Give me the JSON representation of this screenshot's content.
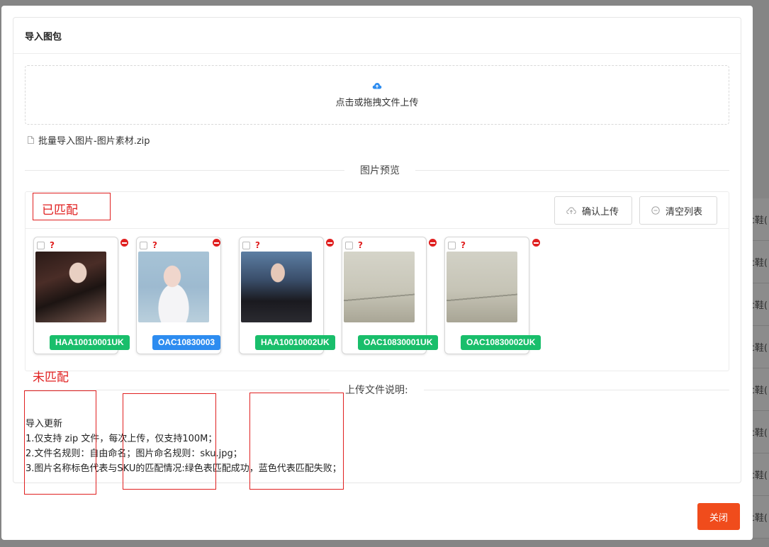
{
  "background": {
    "row_text": "c鞋("
  },
  "modal": {
    "title": "导入图包",
    "dropzone_text": "点击或拖拽文件上传",
    "file_name": "批量导入图片-图片素材.zip",
    "preview_divider": "图片预览",
    "confirm_upload": "确认上传",
    "clear_list": "清空列表",
    "images": [
      {
        "sku": "HAA10010001UK",
        "status": "matched",
        "color": "#19be6b"
      },
      {
        "sku": "OAC10830003",
        "status": "unmatched",
        "color": "#2d8cf0"
      },
      {
        "sku": "HAA10010002UK",
        "status": "matched",
        "color": "#19be6b"
      },
      {
        "sku": "OAC10830001UK",
        "status": "matched",
        "color": "#19be6b"
      },
      {
        "sku": "OAC10830002UK",
        "status": "matched",
        "color": "#19be6b"
      }
    ],
    "question_mark": "?",
    "upload_info_divider": "上传文件说明:",
    "notes": [
      "导入更新",
      "1.仅支持 zip 文件，每次上传，仅支持100M；",
      "2.文件名规则：自由命名；图片命名规则：sku.jpg；",
      "3.图片名称标色代表与SKU的匹配情况:绿色表匹配成功，蓝色代表匹配失败；"
    ],
    "close": "关闭"
  },
  "annotations": {
    "matched": "已匹配",
    "unmatched": "未匹配"
  },
  "colors": {
    "accent": "#f04c1c",
    "matched": "#19be6b",
    "unmatched": "#2d8cf0",
    "annotation": "#e02020"
  }
}
